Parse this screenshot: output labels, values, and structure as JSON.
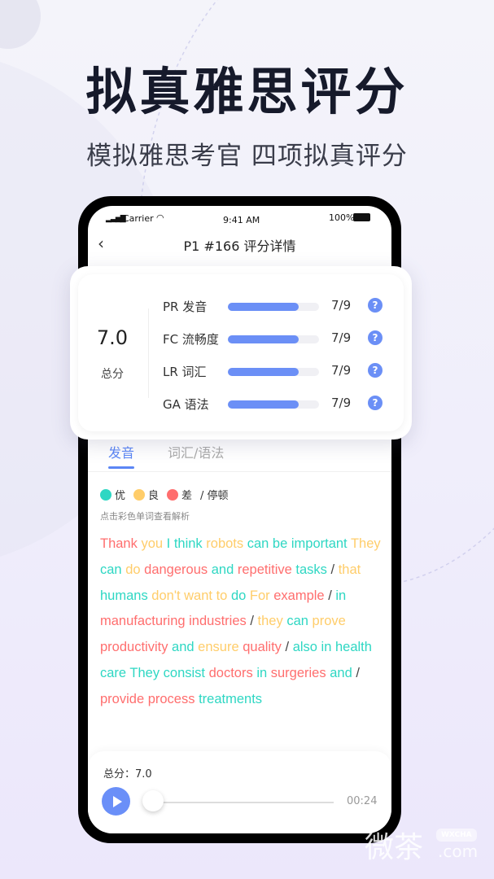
{
  "headline": "拟真雅思评分",
  "subheadline": "模拟雅思考官 四项拟真评分",
  "status": {
    "carrier": "Carrier",
    "time": "9:41 AM",
    "battery": "100%"
  },
  "nav": {
    "title": "P1 #166 评分详情",
    "back_icon": "chevron-left-icon"
  },
  "score": {
    "total": "7.0",
    "total_label": "总分",
    "rows": [
      {
        "label": "PR 发音",
        "value": "7/9",
        "fill": 0.78
      },
      {
        "label": "FC 流畅度",
        "value": "7/9",
        "fill": 0.78
      },
      {
        "label": "LR 词汇",
        "value": "7/9",
        "fill": 0.78
      },
      {
        "label": "GA 语法",
        "value": "7/9",
        "fill": 0.78
      }
    ],
    "help": "?"
  },
  "tabs": [
    {
      "label": "发音",
      "active": true
    },
    {
      "label": "词汇/语法",
      "active": false
    }
  ],
  "legend": [
    {
      "label": "优",
      "color": "#2ed7c3"
    },
    {
      "label": "良",
      "color": "#ffcd6a"
    },
    {
      "label": "差",
      "color": "#ff6e6e"
    },
    {
      "label": "/ 停顿"
    }
  ],
  "hint": "点击彩色单词查看解析",
  "words": [
    [
      "Thank",
      "r"
    ],
    [
      "you",
      "y"
    ],
    [
      "I think",
      "g"
    ],
    [
      "robots",
      "y"
    ],
    [
      "can be important",
      "g"
    ],
    [
      "They",
      "y"
    ],
    [
      "can",
      "g"
    ],
    [
      "do",
      "y"
    ],
    [
      "dangerous",
      "r"
    ],
    [
      "and",
      "g"
    ],
    [
      "repetitive",
      "r"
    ],
    [
      "tasks",
      "g"
    ],
    [
      "/",
      "s"
    ],
    [
      "that",
      "y"
    ],
    [
      "humans",
      "g"
    ],
    [
      "don't want to",
      "y"
    ],
    [
      "do",
      "g"
    ],
    [
      "For",
      "y"
    ],
    [
      "example",
      "r"
    ],
    [
      "/",
      "s"
    ],
    [
      "in",
      "g"
    ],
    [
      "manufacturing industries",
      "r"
    ],
    [
      "/",
      "s"
    ],
    [
      "they",
      "y"
    ],
    [
      "can",
      "g"
    ],
    [
      "prove",
      "y"
    ],
    [
      "productivity",
      "r"
    ],
    [
      "and",
      "g"
    ],
    [
      "ensure",
      "y"
    ],
    [
      "quality",
      "r"
    ],
    [
      "/",
      "s"
    ],
    [
      "also in health care They consist",
      "g"
    ],
    [
      "doctors",
      "r"
    ],
    [
      "in",
      "g"
    ],
    [
      "surgeries",
      "r"
    ],
    [
      "and",
      "g"
    ],
    [
      "/",
      "s"
    ],
    [
      "provide process",
      "r"
    ],
    [
      "treatments",
      "g"
    ]
  ],
  "player": {
    "score": "总分：7.0",
    "time": "00:24",
    "progress": 0
  },
  "colors": {
    "good": "#2ed7c3",
    "fair": "#ffcd6a",
    "poor": "#ff6e6e",
    "accent": "#6b8ff6"
  },
  "watermark": {
    "text": "微茶",
    "badge": "WXCHA",
    "domain": ".com"
  }
}
